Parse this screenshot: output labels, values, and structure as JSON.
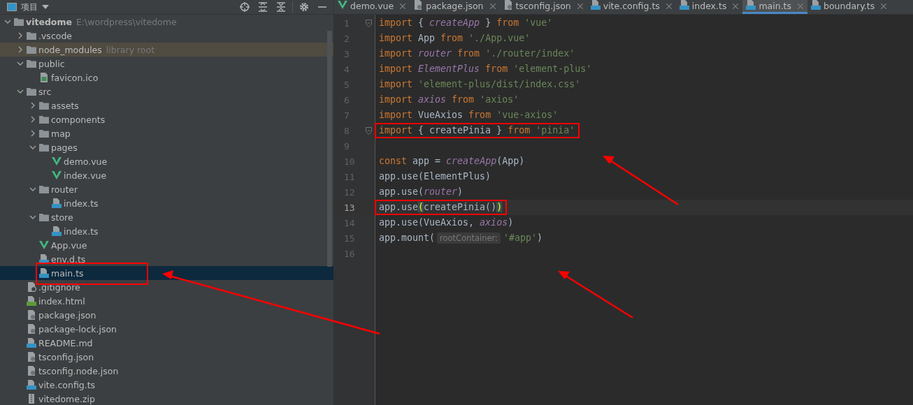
{
  "project_panel": {
    "title": "项目",
    "tree": [
      {
        "name": "vitedome",
        "kind": "folder",
        "bold": true,
        "note": "E:\\wordpress\\vitedome",
        "tinted": false,
        "selected": false,
        "highlighted": false,
        "expanded": true,
        "children": [
          {
            "name": ".vscode",
            "kind": "folder",
            "tinted": false,
            "selected": false,
            "highlighted": false,
            "expanded": false
          },
          {
            "name": "node_modules",
            "kind": "folder",
            "note": "library root",
            "tinted": true,
            "selected": false,
            "highlighted": false,
            "expanded": false
          },
          {
            "name": "public",
            "kind": "folder",
            "tinted": false,
            "selected": false,
            "highlighted": false,
            "expanded": true,
            "children": [
              {
                "name": "favicon.ico",
                "kind": "image",
                "tinted": false,
                "selected": false,
                "highlighted": false
              }
            ]
          },
          {
            "name": "src",
            "kind": "folder",
            "tinted": false,
            "selected": false,
            "highlighted": false,
            "expanded": true,
            "children": [
              {
                "name": "assets",
                "kind": "folder",
                "tinted": false,
                "selected": false,
                "highlighted": false,
                "expanded": false
              },
              {
                "name": "components",
                "kind": "folder",
                "tinted": false,
                "selected": false,
                "highlighted": false,
                "expanded": false
              },
              {
                "name": "map",
                "kind": "folder",
                "tinted": false,
                "selected": false,
                "highlighted": false,
                "expanded": false
              },
              {
                "name": "pages",
                "kind": "folder",
                "tinted": false,
                "selected": false,
                "highlighted": false,
                "expanded": true,
                "children": [
                  {
                    "name": "demo.vue",
                    "kind": "vue",
                    "tinted": false,
                    "selected": false,
                    "highlighted": false
                  },
                  {
                    "name": "index.vue",
                    "kind": "vue",
                    "tinted": false,
                    "selected": false,
                    "highlighted": false
                  }
                ]
              },
              {
                "name": "router",
                "kind": "folder",
                "tinted": false,
                "selected": false,
                "highlighted": false,
                "expanded": true,
                "children": [
                  {
                    "name": "index.ts",
                    "kind": "ts",
                    "tinted": false,
                    "selected": false,
                    "highlighted": false
                  }
                ]
              },
              {
                "name": "store",
                "kind": "folder",
                "tinted": false,
                "selected": false,
                "highlighted": false,
                "expanded": true,
                "children": [
                  {
                    "name": "index.ts",
                    "kind": "ts",
                    "tinted": false,
                    "selected": false,
                    "highlighted": false
                  }
                ]
              },
              {
                "name": "App.vue",
                "kind": "vue",
                "tinted": false,
                "selected": false,
                "highlighted": false
              },
              {
                "name": "env.d.ts",
                "kind": "ts",
                "tinted": false,
                "selected": false,
                "highlighted": false
              },
              {
                "name": "main.ts",
                "kind": "ts",
                "tinted": false,
                "selected": true,
                "highlighted": true
              }
            ]
          },
          {
            "name": ".gitignore",
            "kind": "ignore",
            "tinted": false,
            "selected": false,
            "highlighted": false
          },
          {
            "name": "index.html",
            "kind": "html",
            "tinted": false,
            "selected": false,
            "highlighted": false
          },
          {
            "name": "package.json",
            "kind": "json",
            "tinted": false,
            "selected": false,
            "highlighted": false
          },
          {
            "name": "package-lock.json",
            "kind": "json",
            "tinted": false,
            "selected": false,
            "highlighted": false
          },
          {
            "name": "README.md",
            "kind": "md",
            "tinted": false,
            "selected": false,
            "highlighted": false
          },
          {
            "name": "tsconfig.json",
            "kind": "json",
            "tinted": false,
            "selected": false,
            "highlighted": false
          },
          {
            "name": "tsconfig.node.json",
            "kind": "json",
            "tinted": false,
            "selected": false,
            "highlighted": false
          },
          {
            "name": "vite.config.ts",
            "kind": "ts",
            "tinted": false,
            "selected": false,
            "highlighted": false
          },
          {
            "name": "vitedome.zip",
            "kind": "zip",
            "tinted": false,
            "selected": false,
            "highlighted": false
          }
        ]
      }
    ]
  },
  "editor": {
    "tabs": [
      {
        "label": "demo.vue",
        "kind": "vue",
        "selected": false
      },
      {
        "label": "package.json",
        "kind": "json",
        "selected": false
      },
      {
        "label": "tsconfig.json",
        "kind": "json",
        "selected": false
      },
      {
        "label": "vite.config.ts",
        "kind": "ts",
        "selected": false
      },
      {
        "label": "index.ts",
        "kind": "ts",
        "selected": false
      },
      {
        "label": "main.ts",
        "kind": "ts",
        "selected": true
      },
      {
        "label": "boundary.ts",
        "kind": "ts",
        "selected": false
      }
    ],
    "lines": [
      {
        "number": "1",
        "fold": true,
        "current": false,
        "highlighted": false,
        "tokens": [
          {
            "kind": "keyword",
            "text": "import "
          },
          {
            "kind": "plain",
            "text": "{ "
          },
          {
            "kind": "italic",
            "text": "createApp"
          },
          {
            "kind": "plain",
            "text": " } "
          },
          {
            "kind": "keyword",
            "text": "from "
          },
          {
            "kind": "string",
            "text": "'vue'"
          }
        ]
      },
      {
        "number": "2",
        "fold": false,
        "current": false,
        "highlighted": false,
        "tokens": [
          {
            "kind": "keyword",
            "text": "import "
          },
          {
            "kind": "plain",
            "text": "App "
          },
          {
            "kind": "keyword",
            "text": "from "
          },
          {
            "kind": "string",
            "text": "'./App.vue'"
          }
        ]
      },
      {
        "number": "3",
        "fold": false,
        "current": false,
        "highlighted": false,
        "tokens": [
          {
            "kind": "keyword",
            "text": "import "
          },
          {
            "kind": "italic",
            "text": "router"
          },
          {
            "kind": "keyword",
            "text": " from "
          },
          {
            "kind": "string",
            "text": "'./router/index'"
          }
        ]
      },
      {
        "number": "4",
        "fold": false,
        "current": false,
        "highlighted": false,
        "tokens": [
          {
            "kind": "keyword",
            "text": "import "
          },
          {
            "kind": "italic",
            "text": "ElementPlus"
          },
          {
            "kind": "keyword",
            "text": " from "
          },
          {
            "kind": "string",
            "text": "'element-plus'"
          }
        ]
      },
      {
        "number": "5",
        "fold": false,
        "current": false,
        "highlighted": false,
        "tokens": [
          {
            "kind": "keyword",
            "text": "import "
          },
          {
            "kind": "string",
            "text": "'element-plus/dist/index.css'"
          }
        ]
      },
      {
        "number": "6",
        "fold": false,
        "current": false,
        "highlighted": false,
        "tokens": [
          {
            "kind": "keyword",
            "text": "import "
          },
          {
            "kind": "italic",
            "text": "axios"
          },
          {
            "kind": "keyword",
            "text": " from "
          },
          {
            "kind": "string",
            "text": "'axios'"
          }
        ]
      },
      {
        "number": "7",
        "fold": false,
        "current": false,
        "highlighted": false,
        "tokens": [
          {
            "kind": "keyword",
            "text": "import "
          },
          {
            "kind": "plain",
            "text": "VueAxios "
          },
          {
            "kind": "keyword",
            "text": "from "
          },
          {
            "kind": "string",
            "text": "'vue-axios'"
          }
        ]
      },
      {
        "number": "8",
        "fold": true,
        "current": false,
        "highlighted": true,
        "tokens": [
          {
            "kind": "keyword",
            "text": "import "
          },
          {
            "kind": "plain",
            "text": "{ createPinia } "
          },
          {
            "kind": "keyword",
            "text": "from "
          },
          {
            "kind": "string",
            "text": "'pinia'"
          }
        ]
      },
      {
        "number": "9",
        "fold": false,
        "current": false,
        "highlighted": false
      },
      {
        "number": "10",
        "fold": false,
        "current": false,
        "highlighted": false,
        "tokens": [
          {
            "kind": "keyword",
            "text": "const "
          },
          {
            "kind": "plain",
            "text": "app = "
          },
          {
            "kind": "italic",
            "text": "createApp"
          },
          {
            "kind": "plain",
            "text": "(App)"
          }
        ]
      },
      {
        "number": "11",
        "fold": false,
        "current": false,
        "highlighted": false,
        "tokens": [
          {
            "kind": "plain",
            "text": "app.use(ElementPlus)"
          }
        ]
      },
      {
        "number": "12",
        "fold": false,
        "current": false,
        "highlighted": false,
        "tokens": [
          {
            "kind": "plain",
            "text": "app.use("
          },
          {
            "kind": "italic",
            "text": "router"
          },
          {
            "kind": "plain",
            "text": ")"
          }
        ]
      },
      {
        "number": "13",
        "fold": false,
        "current": true,
        "highlighted": true,
        "tokens": [
          {
            "kind": "plain",
            "text": "app.use"
          },
          {
            "kind": "match",
            "text": "("
          },
          {
            "kind": "plain",
            "text": "createPinia()"
          },
          {
            "kind": "match",
            "text": ")"
          }
        ]
      },
      {
        "number": "14",
        "fold": false,
        "current": false,
        "highlighted": false,
        "tokens": [
          {
            "kind": "plain",
            "text": "app.use(VueAxios, "
          },
          {
            "kind": "italic",
            "text": "axios"
          },
          {
            "kind": "plain",
            "text": ")"
          }
        ]
      },
      {
        "number": "15",
        "fold": false,
        "current": false,
        "highlighted": false,
        "tokens": [
          {
            "kind": "plain",
            "text": "app.mount("
          },
          {
            "kind": "hint",
            "text": "rootContainer:"
          },
          {
            "kind": "string",
            "text": "'#app'"
          },
          {
            "kind": "plain",
            "text": ")"
          }
        ]
      },
      {
        "number": "16",
        "fold": false,
        "current": false,
        "highlighted": false
      }
    ]
  }
}
